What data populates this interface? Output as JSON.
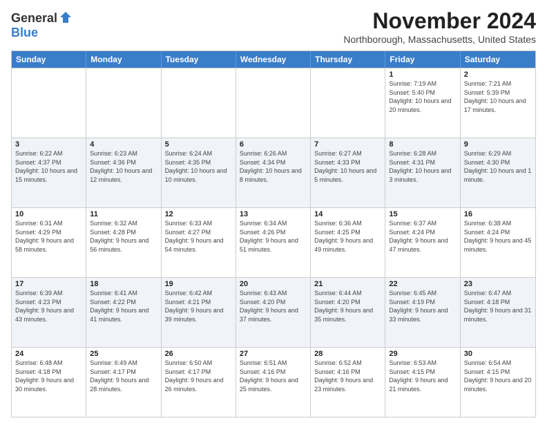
{
  "logo": {
    "general": "General",
    "blue": "Blue"
  },
  "title": "November 2024",
  "location": "Northborough, Massachusetts, United States",
  "days_of_week": [
    "Sunday",
    "Monday",
    "Tuesday",
    "Wednesday",
    "Thursday",
    "Friday",
    "Saturday"
  ],
  "rows": [
    {
      "alt": false,
      "cells": [
        {
          "day": "",
          "info": ""
        },
        {
          "day": "",
          "info": ""
        },
        {
          "day": "",
          "info": ""
        },
        {
          "day": "",
          "info": ""
        },
        {
          "day": "",
          "info": ""
        },
        {
          "day": "1",
          "info": "Sunrise: 7:19 AM\nSunset: 5:40 PM\nDaylight: 10 hours and 20 minutes."
        },
        {
          "day": "2",
          "info": "Sunrise: 7:21 AM\nSunset: 5:39 PM\nDaylight: 10 hours and 17 minutes."
        }
      ]
    },
    {
      "alt": true,
      "cells": [
        {
          "day": "3",
          "info": "Sunrise: 6:22 AM\nSunset: 4:37 PM\nDaylight: 10 hours and 15 minutes."
        },
        {
          "day": "4",
          "info": "Sunrise: 6:23 AM\nSunset: 4:36 PM\nDaylight: 10 hours and 12 minutes."
        },
        {
          "day": "5",
          "info": "Sunrise: 6:24 AM\nSunset: 4:35 PM\nDaylight: 10 hours and 10 minutes."
        },
        {
          "day": "6",
          "info": "Sunrise: 6:26 AM\nSunset: 4:34 PM\nDaylight: 10 hours and 8 minutes."
        },
        {
          "day": "7",
          "info": "Sunrise: 6:27 AM\nSunset: 4:33 PM\nDaylight: 10 hours and 5 minutes."
        },
        {
          "day": "8",
          "info": "Sunrise: 6:28 AM\nSunset: 4:31 PM\nDaylight: 10 hours and 3 minutes."
        },
        {
          "day": "9",
          "info": "Sunrise: 6:29 AM\nSunset: 4:30 PM\nDaylight: 10 hours and 1 minute."
        }
      ]
    },
    {
      "alt": false,
      "cells": [
        {
          "day": "10",
          "info": "Sunrise: 6:31 AM\nSunset: 4:29 PM\nDaylight: 9 hours and 58 minutes."
        },
        {
          "day": "11",
          "info": "Sunrise: 6:32 AM\nSunset: 4:28 PM\nDaylight: 9 hours and 56 minutes."
        },
        {
          "day": "12",
          "info": "Sunrise: 6:33 AM\nSunset: 4:27 PM\nDaylight: 9 hours and 54 minutes."
        },
        {
          "day": "13",
          "info": "Sunrise: 6:34 AM\nSunset: 4:26 PM\nDaylight: 9 hours and 51 minutes."
        },
        {
          "day": "14",
          "info": "Sunrise: 6:36 AM\nSunset: 4:25 PM\nDaylight: 9 hours and 49 minutes."
        },
        {
          "day": "15",
          "info": "Sunrise: 6:37 AM\nSunset: 4:24 PM\nDaylight: 9 hours and 47 minutes."
        },
        {
          "day": "16",
          "info": "Sunrise: 6:38 AM\nSunset: 4:24 PM\nDaylight: 9 hours and 45 minutes."
        }
      ]
    },
    {
      "alt": true,
      "cells": [
        {
          "day": "17",
          "info": "Sunrise: 6:39 AM\nSunset: 4:23 PM\nDaylight: 9 hours and 43 minutes."
        },
        {
          "day": "18",
          "info": "Sunrise: 6:41 AM\nSunset: 4:22 PM\nDaylight: 9 hours and 41 minutes."
        },
        {
          "day": "19",
          "info": "Sunrise: 6:42 AM\nSunset: 4:21 PM\nDaylight: 9 hours and 39 minutes."
        },
        {
          "day": "20",
          "info": "Sunrise: 6:43 AM\nSunset: 4:20 PM\nDaylight: 9 hours and 37 minutes."
        },
        {
          "day": "21",
          "info": "Sunrise: 6:44 AM\nSunset: 4:20 PM\nDaylight: 9 hours and 35 minutes."
        },
        {
          "day": "22",
          "info": "Sunrise: 6:45 AM\nSunset: 4:19 PM\nDaylight: 9 hours and 33 minutes."
        },
        {
          "day": "23",
          "info": "Sunrise: 6:47 AM\nSunset: 4:18 PM\nDaylight: 9 hours and 31 minutes."
        }
      ]
    },
    {
      "alt": false,
      "cells": [
        {
          "day": "24",
          "info": "Sunrise: 6:48 AM\nSunset: 4:18 PM\nDaylight: 9 hours and 30 minutes."
        },
        {
          "day": "25",
          "info": "Sunrise: 6:49 AM\nSunset: 4:17 PM\nDaylight: 9 hours and 28 minutes."
        },
        {
          "day": "26",
          "info": "Sunrise: 6:50 AM\nSunset: 4:17 PM\nDaylight: 9 hours and 26 minutes."
        },
        {
          "day": "27",
          "info": "Sunrise: 6:51 AM\nSunset: 4:16 PM\nDaylight: 9 hours and 25 minutes."
        },
        {
          "day": "28",
          "info": "Sunrise: 6:52 AM\nSunset: 4:16 PM\nDaylight: 9 hours and 23 minutes."
        },
        {
          "day": "29",
          "info": "Sunrise: 6:53 AM\nSunset: 4:15 PM\nDaylight: 9 hours and 21 minutes."
        },
        {
          "day": "30",
          "info": "Sunrise: 6:54 AM\nSunset: 4:15 PM\nDaylight: 9 hours and 20 minutes."
        }
      ]
    }
  ]
}
